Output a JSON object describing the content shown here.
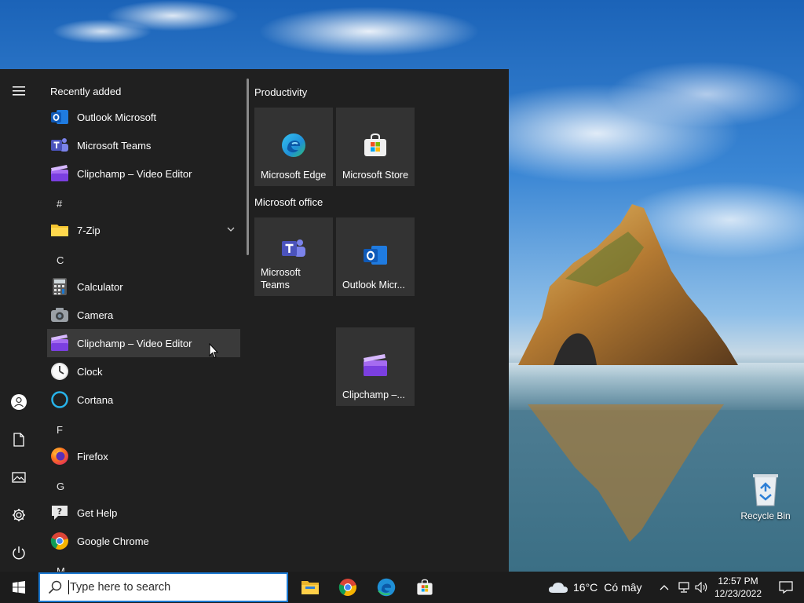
{
  "desktop": {
    "recycle_bin_label": "Recycle Bin"
  },
  "start_menu": {
    "rail": {
      "icons": [
        "hamburger-icon",
        "user-icon",
        "document-icon",
        "pictures-icon",
        "settings-icon",
        "power-icon"
      ]
    },
    "recently_added_header": "Recently added",
    "recent_apps": [
      {
        "label": "Outlook Microsoft",
        "icon": "outlook-icon"
      },
      {
        "label": "Microsoft Teams",
        "icon": "teams-icon"
      },
      {
        "label": "Clipchamp – Video Editor",
        "icon": "clipchamp-icon"
      }
    ],
    "sections": [
      {
        "letter": "#",
        "apps": [
          {
            "label": "7-Zip",
            "icon": "folder-icon",
            "expandable": true
          }
        ]
      },
      {
        "letter": "C",
        "apps": [
          {
            "label": "Calculator",
            "icon": "calculator-icon"
          },
          {
            "label": "Camera",
            "icon": "camera-icon"
          },
          {
            "label": "Clipchamp – Video Editor",
            "icon": "clipchamp-icon",
            "hovered": true
          },
          {
            "label": "Clock",
            "icon": "clock-icon"
          },
          {
            "label": "Cortana",
            "icon": "cortana-icon"
          }
        ]
      },
      {
        "letter": "F",
        "apps": [
          {
            "label": "Firefox",
            "icon": "firefox-icon"
          }
        ]
      },
      {
        "letter": "G",
        "apps": [
          {
            "label": "Get Help",
            "icon": "get-help-icon"
          },
          {
            "label": "Google Chrome",
            "icon": "chrome-icon"
          }
        ]
      },
      {
        "letter": "M",
        "apps": []
      }
    ],
    "tile_groups": [
      {
        "title": "Productivity",
        "tiles": [
          {
            "label": "Microsoft Edge",
            "icon": "edge-icon"
          },
          {
            "label": "Microsoft Store",
            "icon": "store-icon"
          }
        ]
      },
      {
        "title": "Microsoft office",
        "tiles": [
          {
            "label": "Microsoft Teams",
            "icon": "teams-icon"
          },
          {
            "label": "Outlook Micr...",
            "icon": "outlook-icon"
          },
          {
            "label": "Clipchamp –...",
            "icon": "clipchamp-icon"
          }
        ]
      }
    ]
  },
  "taskbar": {
    "search_placeholder": "Type here to search",
    "pinned_apps": [
      "file-explorer-icon",
      "chrome-icon",
      "edge-icon",
      "store-icon"
    ],
    "weather": {
      "temperature": "16°C",
      "condition": "Có mây",
      "icon": "cloud-icon"
    },
    "tray_icons": [
      "chevron-up-icon",
      "network-icon",
      "volume-icon"
    ],
    "clock": {
      "time": "12:57 PM",
      "date": "12/23/2022"
    },
    "notification_icon": "notification-icon"
  },
  "colors": {
    "start_bg": "#202020",
    "tile_bg": "#333333",
    "taskbar_bg": "#1c1c1c",
    "accent": "#1b78d0",
    "hover_bg": "#3a3a3a"
  }
}
